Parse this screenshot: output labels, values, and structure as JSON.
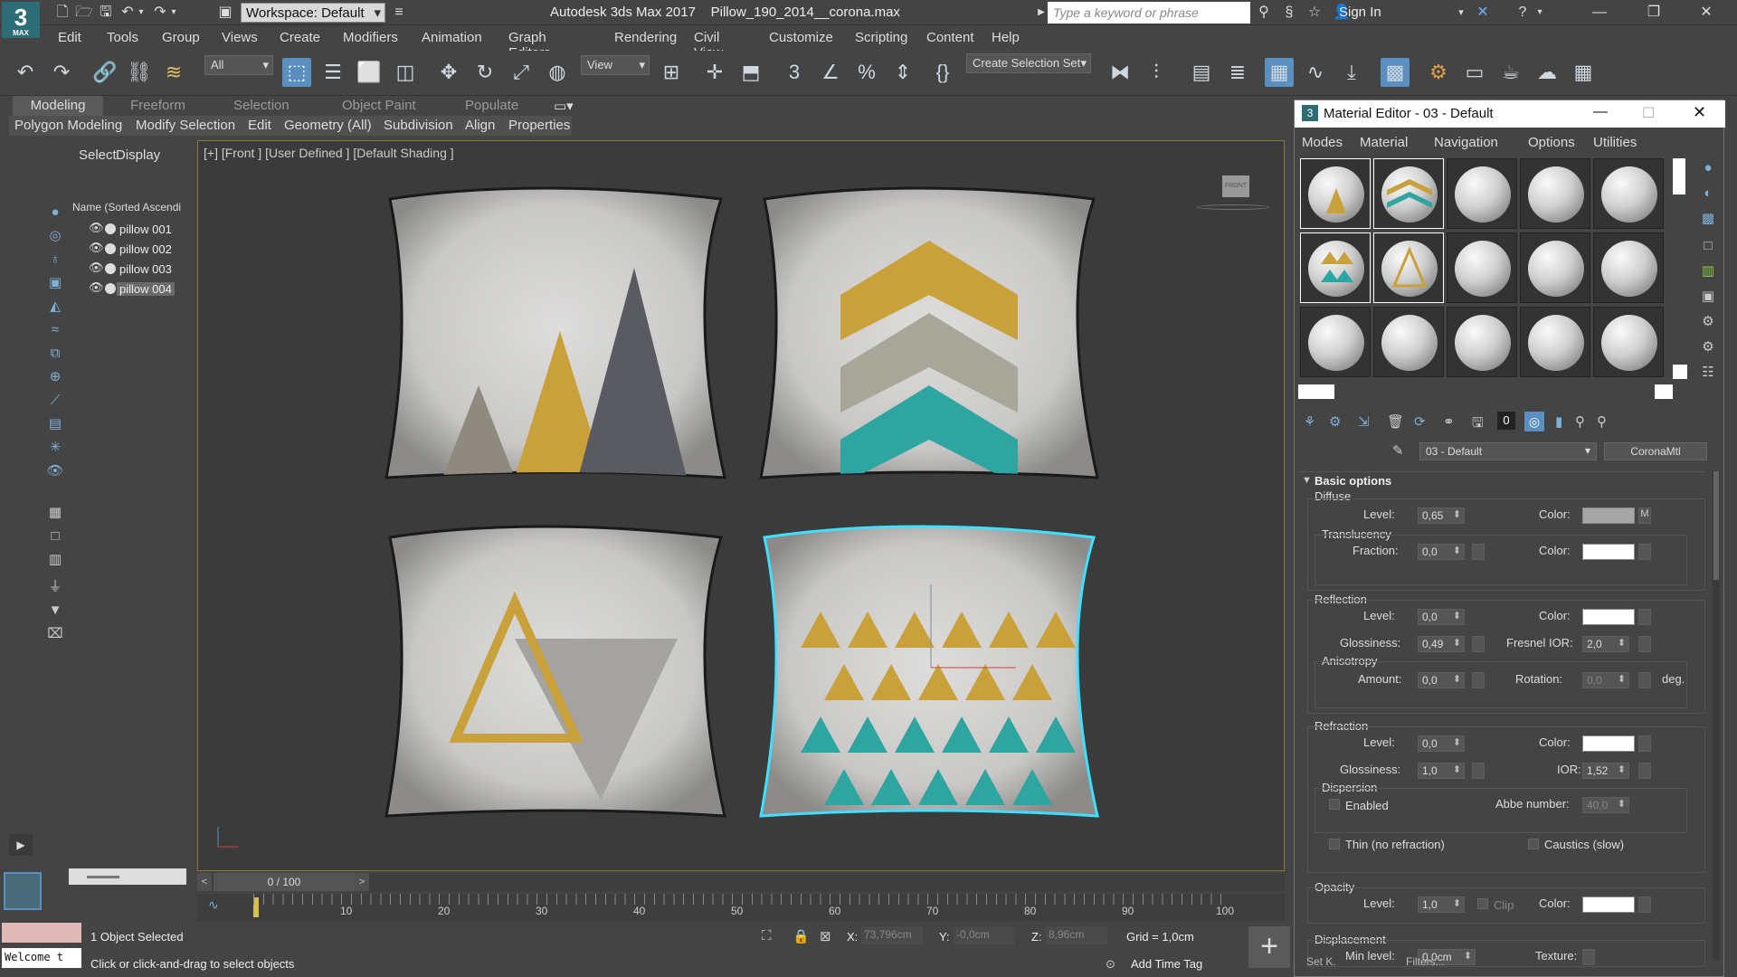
{
  "app": {
    "title": "Autodesk 3ds Max 2017",
    "file": "Pillow_190_2014__corona.max",
    "logo_text": "3",
    "logo_sub": "MAX",
    "workspace": "Workspace: Default",
    "search_placeholder": "Type a keyword or phrase",
    "sign_in": "Sign In"
  },
  "menus": [
    "Edit",
    "Tools",
    "Group",
    "Views",
    "Create",
    "Modifiers",
    "Animation",
    "Graph Editors",
    "Rendering",
    "Civil View",
    "Customize",
    "Scripting",
    "Content",
    "Help"
  ],
  "toolbar": {
    "filter": "All",
    "ref_coord": "View",
    "selection_set": "Create Selection Set"
  },
  "ribbon": {
    "tabs": [
      "Modeling",
      "Freeform",
      "Selection",
      "Object Paint",
      "Populate"
    ],
    "subtabs": [
      "Polygon Modeling",
      "Modify Selection",
      "Edit",
      "Geometry (All)",
      "Subdivision",
      "Align",
      "Properties"
    ]
  },
  "explorer": {
    "tabs": [
      "Select",
      "Display"
    ],
    "header": "Name (Sorted Ascendi",
    "items": [
      "pillow 001",
      "pillow 002",
      "pillow 003",
      "pillow 004"
    ]
  },
  "viewport": {
    "label": "[+] [Front ] [User Defined ] [Default Shading ]",
    "viewcube": "FRONT"
  },
  "timeline": {
    "frame": "0 / 100",
    "ticks": [
      "10",
      "20",
      "30",
      "40",
      "50",
      "60",
      "70",
      "80",
      "90",
      "100"
    ]
  },
  "status": {
    "selected": "1 Object Selected",
    "prompt": "Click or click-and-drag to select objects",
    "welcome": "Welcome t",
    "x_label": "X:",
    "x": "73,796cm",
    "y_label": "Y:",
    "y": "-0,0cm",
    "z_label": "Z:",
    "z": "8,96cm",
    "grid": "Grid = 1,0cm",
    "add_time_tag": "Add Time Tag",
    "set_key": "Set K.",
    "filters": "Filters..."
  },
  "material_editor": {
    "title": "Material Editor - 03 - Default",
    "menus": [
      "Modes",
      "Material",
      "Navigation",
      "Options",
      "Utilities"
    ],
    "material_name": "03 - Default",
    "material_type": "CoronaMtl",
    "rollout": "Basic options",
    "diffuse": {
      "section": "Diffuse",
      "level_label": "Level:",
      "level": "0,65",
      "color_label": "Color:",
      "map_btn": "M"
    },
    "translucency": {
      "section": "Translucency",
      "fraction_label": "Fraction:",
      "fraction": "0,0",
      "color_label": "Color:"
    },
    "reflection": {
      "section": "Reflection",
      "level_label": "Level:",
      "level": "0,0",
      "color_label": "Color:",
      "gloss_label": "Glossiness:",
      "gloss": "0,49",
      "fresnel_label": "Fresnel IOR:",
      "fresnel": "2,0",
      "aniso": "Anisotropy",
      "amount_label": "Amount:",
      "amount": "0,0",
      "rotation_label": "Rotation:",
      "rotation": "0,0",
      "deg": "deg."
    },
    "refraction": {
      "section": "Refraction",
      "level_label": "Level:",
      "level": "0,0",
      "color_label": "Color:",
      "gloss_label": "Glossiness:",
      "gloss": "1,0",
      "ior_label": "IOR:",
      "ior": "1,52",
      "dispersion": "Dispersion",
      "enabled": "Enabled",
      "abbe_label": "Abbe number:",
      "abbe": "40,0",
      "thin": "Thin (no refraction)",
      "caustics": "Caustics (slow)"
    },
    "opacity": {
      "section": "Opacity",
      "level_label": "Level:",
      "level": "1,0",
      "clip": "Clip",
      "color_label": "Color:"
    },
    "displacement": {
      "section": "Displacement",
      "min_label": "Min level:",
      "min": "0,0cm",
      "texture_label": "Texture:"
    }
  },
  "colors": {
    "accent": "#5a8fc0",
    "mustard": "#c9a13a",
    "teal": "#2ea5a0",
    "charcoal": "#5a5a62",
    "selection": "#3fe0ff"
  }
}
